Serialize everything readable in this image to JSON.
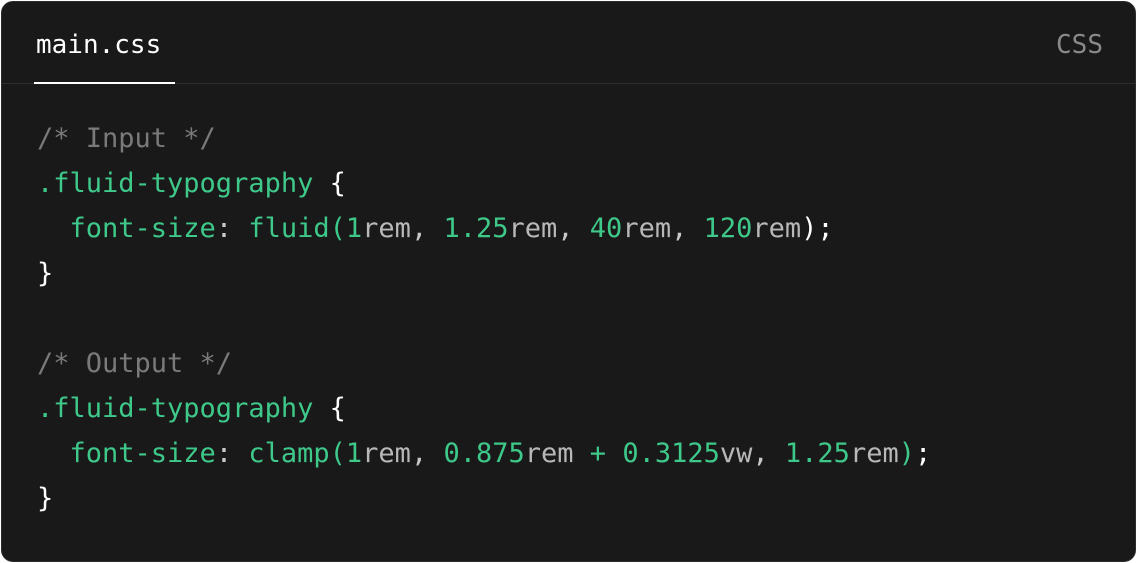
{
  "tab": {
    "filename": "main.css",
    "language": "CSS"
  },
  "code": {
    "input_comment": "/* Input */",
    "output_comment": "/* Output */",
    "selector": ".fluid-typography",
    "open_brace": "{",
    "close_brace": "}",
    "property": "font-size",
    "colon": ":",
    "input_value": {
      "func": "fluid(",
      "args": [
        {
          "num": "1",
          "unit": "rem"
        },
        {
          "num": "1.25",
          "unit": "rem"
        },
        {
          "num": "40",
          "unit": "rem"
        },
        {
          "num": "120",
          "unit": "rem"
        }
      ],
      "close": ");"
    },
    "output_value": {
      "func": "clamp(",
      "arg1_num": "1",
      "arg1_unit": "rem",
      "arg2_num_a": "0.875",
      "arg2_unit_a": "rem",
      "plus": "+",
      "arg2_num_b": "0.3125",
      "arg2_unit_b": "vw",
      "arg3_num": "1.25",
      "arg3_unit": "rem",
      "close_paren": ")",
      "semicolon": ";"
    },
    "separator": ", "
  },
  "colors": {
    "background": "#191919",
    "accent_green": "#3ec98a",
    "comment": "#7a7a7a"
  }
}
